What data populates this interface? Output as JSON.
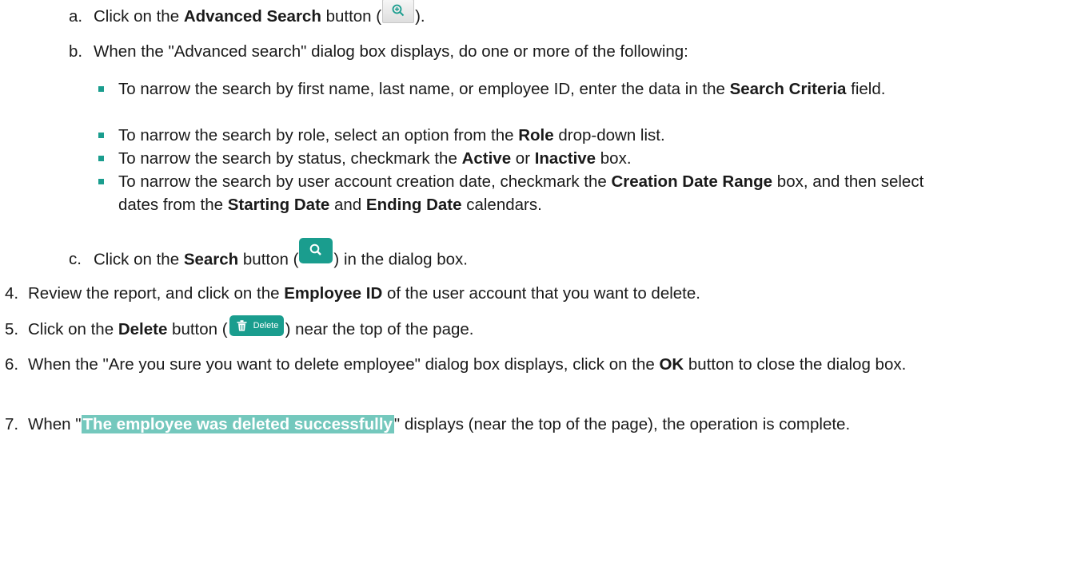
{
  "steps": {
    "a": {
      "marker": "a.",
      "pre": "Click on the ",
      "bold": "Advanced Search",
      "mid": " button (",
      "post": ")."
    },
    "b": {
      "marker": "b.",
      "text": "When the \"Advanced search\" dialog box displays, do one or more of the following:"
    },
    "bullets": [
      {
        "pre": "To narrow the search by first name, last name, or employee ID, enter the data in the ",
        "bold": "Search Criteria",
        "post": " field."
      },
      {
        "pre": "To narrow the search by role, select an option from the ",
        "bold": "Role",
        "post": " drop-down list."
      },
      {
        "pre": "To narrow the search by status, checkmark the ",
        "bold": "Active",
        "mid": " or ",
        "bold2": "Inactive",
        "post": " box."
      },
      {
        "pre": "To narrow the search by user account creation date, checkmark the ",
        "bold": "Creation Date Range",
        "mid": " box, and then select dates from the ",
        "bold2": "Starting Date",
        "mid2": " and ",
        "bold3": "Ending Date",
        "post": " calendars."
      }
    ],
    "c": {
      "marker": "c.",
      "pre": "Click on the ",
      "bold": "Search",
      "mid": " button (",
      "post": ") in the dialog box."
    },
    "s4": {
      "marker": "4.",
      "pre": "Review the report, and click on the ",
      "bold": "Employee ID",
      "post": " of the user account that you want to delete."
    },
    "s5": {
      "marker": "5.",
      "pre": "Click on the ",
      "bold": "Delete",
      "mid": " button (",
      "post": ") near the top of the page.",
      "button_label": "Delete"
    },
    "s6": {
      "marker": "6.",
      "pre": "When the \"Are you sure you want to delete employee\" dialog box displays, click on the ",
      "bold": "OK",
      "post": " button to close the dialog box."
    },
    "s7": {
      "marker": "7.",
      "pre": "When \"",
      "highlight": "The employee was deleted successfully",
      "post": "\" displays (near the top of the page), the operation is complete."
    }
  },
  "colors": {
    "accent": "#1a9d8e",
    "highlight": "#74c8bd",
    "bullet": "#1a9d8e"
  },
  "icons": {
    "advanced_search": "zoom-in-icon",
    "search": "search-icon",
    "delete": "trash-icon"
  }
}
